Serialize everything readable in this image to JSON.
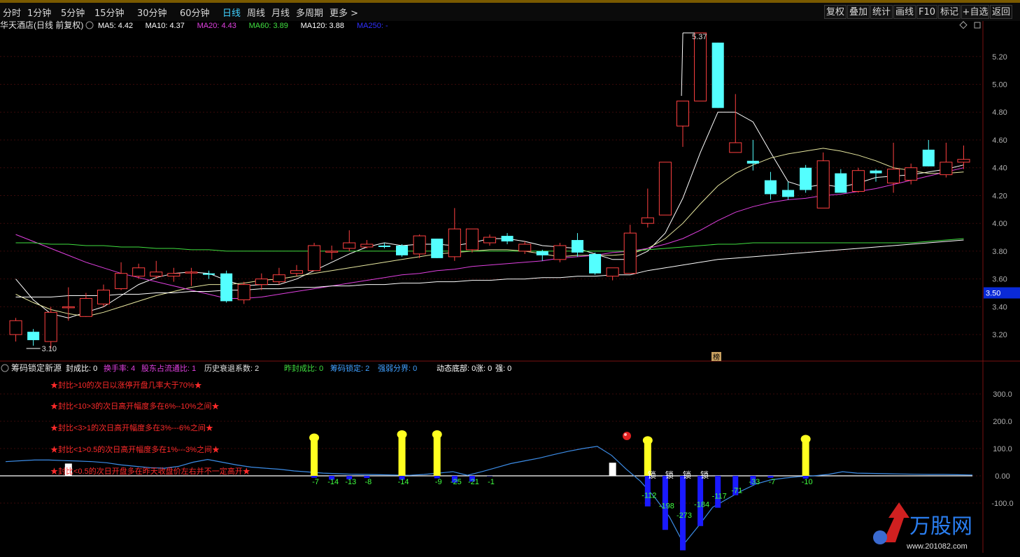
{
  "topbar": {
    "periods": [
      "分时",
      "1分钟",
      "5分钟",
      "15分钟",
      "30分钟",
      "60分钟",
      "日线",
      "周线",
      "月线",
      "多周期",
      "更多 >"
    ],
    "active_period": "日线",
    "right_buttons": [
      "复权",
      "叠加",
      "统计",
      "画线",
      "F10",
      "标记",
      "+自选",
      "返回"
    ]
  },
  "main_panel": {
    "title": "华天酒店(日线 前复权)",
    "ma_labels": [
      {
        "text": "MA5: 4.42",
        "color": "#ffffff"
      },
      {
        "text": "MA10: 4.37",
        "color": "#ffffff"
      },
      {
        "text": "MA20: 4.43",
        "color": "#e040e0"
      },
      {
        "text": "MA60: 3.89",
        "color": "#40e040"
      },
      {
        "text": "MA120: 3.88",
        "color": "#ffffff"
      },
      {
        "text": "MA250: -",
        "color": "#3030ff"
      }
    ],
    "current_price_tag": "3.50",
    "high_annotation": "5.37",
    "low_annotation": "3.10",
    "marker_glyph": "榜"
  },
  "sub_panel": {
    "title": "筹码锁定新源",
    "stats": [
      {
        "text": "封成比: 0",
        "color": "#ffffff"
      },
      {
        "text": "换手率: 4",
        "color": "#e040e0"
      },
      {
        "text": "股东占流通比: 1",
        "color": "#e040e0"
      },
      {
        "text": "历史衰退系数: 2",
        "color": "#e0e0e0"
      },
      {
        "text": "昨封成比: 0",
        "color": "#40e040"
      },
      {
        "text": "筹码锁定: 2",
        "color": "#40a0ff"
      },
      {
        "text": "强弱分界: 0",
        "color": "#40a0ff"
      },
      {
        "text": "动态底部: 0",
        "color": "#ffffff"
      },
      {
        "text": "涨: 0",
        "color": "#ffffff"
      },
      {
        "text": "强: 0",
        "color": "#ffffff"
      }
    ],
    "notes": [
      "★封比>10的次日以涨停开盘几率大于70%★",
      "★封比<10>3的次日高开幅度多在6%--10%之间★",
      "★封比<3>1的次日高开幅度多在3%---6%之间★",
      "★封比<1>0.5的次日高开幅度多在1%---3%之间★",
      "★封比<0.5的次日开盘多在昨天收盘价左右并不一定高开★"
    ],
    "lock_labels": [
      "锁",
      "锁",
      "锁",
      "锁"
    ]
  },
  "watermark": {
    "brand": "万股网",
    "url": "www.201082.com"
  },
  "chart_data": [
    {
      "type": "candlestick",
      "title": "华天酒店(日线 前复权)",
      "ylim": [
        3.1,
        5.37
      ],
      "yticks": [
        "5.20",
        "5.00",
        "4.80",
        "4.60",
        "4.40",
        "4.20",
        "4.00",
        "3.80",
        "3.60",
        "3.40",
        "3.20"
      ],
      "candles": [
        {
          "o": 3.2,
          "c": 3.3,
          "h": 3.32,
          "l": 3.15
        },
        {
          "o": 3.22,
          "c": 3.16,
          "h": 3.24,
          "l": 3.12
        },
        {
          "o": 3.15,
          "c": 3.36,
          "h": 3.4,
          "l": 3.1
        },
        {
          "o": 3.4,
          "c": 3.4,
          "h": 3.54,
          "l": 3.3
        },
        {
          "o": 3.33,
          "c": 3.46,
          "h": 3.5,
          "l": 3.33
        },
        {
          "o": 3.42,
          "c": 3.52,
          "h": 3.56,
          "l": 3.4
        },
        {
          "o": 3.53,
          "c": 3.64,
          "h": 3.72,
          "l": 3.52
        },
        {
          "o": 3.62,
          "c": 3.68,
          "h": 3.71,
          "l": 3.6
        },
        {
          "o": 3.62,
          "c": 3.65,
          "h": 3.73,
          "l": 3.6
        },
        {
          "o": 3.62,
          "c": 3.64,
          "h": 3.68,
          "l": 3.58
        },
        {
          "o": 3.65,
          "c": 3.65,
          "h": 3.68,
          "l": 3.55
        },
        {
          "o": 3.64,
          "c": 3.63,
          "h": 3.66,
          "l": 3.6
        },
        {
          "o": 3.64,
          "c": 3.44,
          "h": 3.66,
          "l": 3.43
        },
        {
          "o": 3.45,
          "c": 3.56,
          "h": 3.58,
          "l": 3.42
        },
        {
          "o": 3.56,
          "c": 3.6,
          "h": 3.64,
          "l": 3.52
        },
        {
          "o": 3.58,
          "c": 3.63,
          "h": 3.68,
          "l": 3.56
        },
        {
          "o": 3.64,
          "c": 3.66,
          "h": 3.7,
          "l": 3.62
        },
        {
          "o": 3.66,
          "c": 3.84,
          "h": 3.86,
          "l": 3.66
        },
        {
          "o": 3.8,
          "c": 3.8,
          "h": 3.84,
          "l": 3.74
        },
        {
          "o": 3.82,
          "c": 3.86,
          "h": 3.95,
          "l": 3.8
        },
        {
          "o": 3.83,
          "c": 3.85,
          "h": 3.88,
          "l": 3.82
        },
        {
          "o": 3.84,
          "c": 3.83,
          "h": 3.86,
          "l": 3.82
        },
        {
          "o": 3.84,
          "c": 3.77,
          "h": 3.85,
          "l": 3.76
        },
        {
          "o": 3.78,
          "c": 3.91,
          "h": 3.92,
          "l": 3.75
        },
        {
          "o": 3.89,
          "c": 3.75,
          "h": 3.89,
          "l": 3.75
        },
        {
          "o": 3.76,
          "c": 3.96,
          "h": 4.11,
          "l": 3.73
        },
        {
          "o": 3.81,
          "c": 3.96,
          "h": 3.96,
          "l": 3.79
        },
        {
          "o": 3.86,
          "c": 3.9,
          "h": 3.92,
          "l": 3.84
        },
        {
          "o": 3.91,
          "c": 3.87,
          "h": 3.93,
          "l": 3.85
        },
        {
          "o": 3.8,
          "c": 3.85,
          "h": 3.87,
          "l": 3.78
        },
        {
          "o": 3.8,
          "c": 3.77,
          "h": 3.81,
          "l": 3.73
        },
        {
          "o": 3.74,
          "c": 3.84,
          "h": 3.86,
          "l": 3.72
        },
        {
          "o": 3.88,
          "c": 3.79,
          "h": 3.93,
          "l": 3.76
        },
        {
          "o": 3.78,
          "c": 3.64,
          "h": 3.79,
          "l": 3.63
        },
        {
          "o": 3.62,
          "c": 3.68,
          "h": 3.68,
          "l": 3.59
        },
        {
          "o": 3.64,
          "c": 3.93,
          "h": 3.99,
          "l": 3.64
        },
        {
          "o": 4.0,
          "c": 4.04,
          "h": 4.25,
          "l": 3.97
        },
        {
          "o": 4.06,
          "c": 4.44,
          "h": 4.44,
          "l": 4.06
        },
        {
          "o": 4.7,
          "c": 4.88,
          "h": 4.88,
          "l": 4.55
        },
        {
          "o": 4.88,
          "c": 5.37,
          "h": 5.37,
          "l": 4.91
        },
        {
          "o": 5.3,
          "c": 4.83,
          "h": 5.3,
          "l": 4.83
        },
        {
          "o": 4.51,
          "c": 4.58,
          "h": 4.93,
          "l": 4.51
        },
        {
          "o": 4.45,
          "c": 4.43,
          "h": 4.6,
          "l": 4.38
        },
        {
          "o": 4.31,
          "c": 4.21,
          "h": 4.37,
          "l": 4.17
        },
        {
          "o": 4.24,
          "c": 4.19,
          "h": 4.3,
          "l": 4.17
        },
        {
          "o": 4.4,
          "c": 4.24,
          "h": 4.42,
          "l": 4.22
        },
        {
          "o": 4.11,
          "c": 4.45,
          "h": 4.51,
          "l": 4.11
        },
        {
          "o": 4.36,
          "c": 4.22,
          "h": 4.39,
          "l": 4.22
        },
        {
          "o": 4.23,
          "c": 4.38,
          "h": 4.4,
          "l": 4.22
        },
        {
          "o": 4.38,
          "c": 4.36,
          "h": 4.39,
          "l": 4.3
        },
        {
          "o": 4.29,
          "c": 4.39,
          "h": 4.58,
          "l": 4.22
        },
        {
          "o": 4.31,
          "c": 4.4,
          "h": 4.43,
          "l": 4.28
        },
        {
          "o": 4.53,
          "c": 4.41,
          "h": 4.6,
          "l": 4.41
        },
        {
          "o": 4.35,
          "c": 4.44,
          "h": 4.58,
          "l": 4.33
        },
        {
          "o": 4.44,
          "c": 4.46,
          "h": 4.56,
          "l": 4.39
        }
      ],
      "ma": [
        {
          "name": "MA5",
          "color": "#ffffff",
          "values": [
            3.6,
            3.45,
            3.35,
            3.32,
            3.36,
            3.4,
            3.48,
            3.56,
            3.61,
            3.64,
            3.65,
            3.64,
            3.59,
            3.55,
            3.56,
            3.56,
            3.6,
            3.66,
            3.72,
            3.78,
            3.83,
            3.86,
            3.84,
            3.85,
            3.85,
            3.84,
            3.86,
            3.89,
            3.89,
            3.87,
            3.84,
            3.83,
            3.82,
            3.78,
            3.74,
            3.74,
            3.8,
            3.93,
            4.18,
            4.51,
            4.8,
            4.8,
            4.73,
            4.51,
            4.3,
            4.26,
            4.28,
            4.26,
            4.29,
            4.33,
            4.34,
            4.35,
            4.37,
            4.39,
            4.42
          ]
        },
        {
          "name": "MA10",
          "color": "#e8e8a0",
          "values": [
            3.49,
            3.43,
            3.38,
            3.35,
            3.33,
            3.36,
            3.4,
            3.44,
            3.48,
            3.51,
            3.54,
            3.56,
            3.56,
            3.57,
            3.59,
            3.6,
            3.62,
            3.64,
            3.66,
            3.68,
            3.7,
            3.72,
            3.74,
            3.76,
            3.78,
            3.79,
            3.8,
            3.81,
            3.81,
            3.8,
            3.78,
            3.76,
            3.77,
            3.77,
            3.77,
            3.78,
            3.82,
            3.89,
            4.0,
            4.14,
            4.27,
            4.36,
            4.42,
            4.47,
            4.5,
            4.52,
            4.54,
            4.52,
            4.49,
            4.45,
            4.4,
            4.38,
            4.36,
            4.36,
            4.37
          ]
        },
        {
          "name": "MA20",
          "color": "#e040e0",
          "values": [
            3.92,
            3.87,
            3.82,
            3.77,
            3.72,
            3.68,
            3.64,
            3.61,
            3.58,
            3.55,
            3.52,
            3.49,
            3.46,
            3.46,
            3.47,
            3.49,
            3.51,
            3.53,
            3.55,
            3.57,
            3.59,
            3.61,
            3.63,
            3.64,
            3.66,
            3.67,
            3.69,
            3.7,
            3.71,
            3.72,
            3.73,
            3.75,
            3.76,
            3.77,
            3.79,
            3.8,
            3.82,
            3.85,
            3.89,
            3.95,
            4.02,
            4.08,
            4.12,
            4.15,
            4.17,
            4.18,
            4.2,
            4.21,
            4.23,
            4.25,
            4.28,
            4.31,
            4.34,
            4.37,
            4.4
          ]
        },
        {
          "name": "MA60",
          "color": "#40e040",
          "values": [
            3.86,
            3.86,
            3.85,
            3.85,
            3.84,
            3.84,
            3.83,
            3.83,
            3.82,
            3.82,
            3.81,
            3.81,
            3.8,
            3.8,
            3.8,
            3.8,
            3.8,
            3.8,
            3.8,
            3.8,
            3.8,
            3.8,
            3.8,
            3.8,
            3.8,
            3.8,
            3.8,
            3.8,
            3.8,
            3.8,
            3.8,
            3.8,
            3.8,
            3.8,
            3.8,
            3.8,
            3.81,
            3.82,
            3.83,
            3.84,
            3.85,
            3.85,
            3.86,
            3.86,
            3.86,
            3.86,
            3.86,
            3.86,
            3.86,
            3.86,
            3.86,
            3.86,
            3.87,
            3.88,
            3.89
          ]
        },
        {
          "name": "MA120",
          "color": "#ffffff",
          "values": [
            3.47,
            3.47,
            3.47,
            3.48,
            3.48,
            3.48,
            3.49,
            3.49,
            3.5,
            3.5,
            3.51,
            3.51,
            3.52,
            3.52,
            3.53,
            3.53,
            3.54,
            3.54,
            3.55,
            3.55,
            3.56,
            3.56,
            3.57,
            3.57,
            3.58,
            3.58,
            3.59,
            3.59,
            3.6,
            3.6,
            3.61,
            3.61,
            3.62,
            3.62,
            3.63,
            3.63,
            3.66,
            3.68,
            3.7,
            3.72,
            3.74,
            3.75,
            3.76,
            3.77,
            3.78,
            3.79,
            3.8,
            3.81,
            3.82,
            3.83,
            3.84,
            3.85,
            3.86,
            3.87,
            3.88
          ]
        }
      ]
    },
    {
      "type": "bar",
      "title": "筹码锁定新源",
      "ylim": [
        -100,
        300
      ],
      "yticks": [
        "300.0",
        "200.0",
        "100.0",
        "0.00",
        "-100.0"
      ],
      "line_values": [
        52,
        55,
        58,
        58,
        56,
        54,
        52,
        48,
        40,
        35,
        30,
        28,
        35,
        50,
        60,
        50,
        40,
        32,
        28,
        24,
        18,
        14,
        10,
        8,
        6,
        5,
        4,
        3,
        2,
        5,
        10,
        15,
        2,
        15,
        30,
        45,
        55,
        65,
        78,
        90,
        100,
        108,
        75,
        25,
        -20,
        -80,
        -150,
        -250,
        -185,
        -115,
        -85,
        -55,
        -30,
        -15,
        -8,
        -3,
        0,
        5,
        15,
        10,
        9,
        8,
        7,
        6,
        5,
        5,
        4,
        3
      ],
      "yellow_bars": [
        {
          "index": 17,
          "value": 150
        },
        {
          "index": 22,
          "value": 162
        },
        {
          "index": 24,
          "value": 162
        },
        {
          "index": 36,
          "value": 140
        },
        {
          "index": 45,
          "value": 145
        }
      ],
      "white_bars": [
        {
          "index": 3,
          "value": 45
        },
        {
          "index": 34,
          "value": 48
        }
      ],
      "blue_bars": [
        {
          "index": 17,
          "value": -7,
          "label": "-7"
        },
        {
          "index": 18,
          "value": -14,
          "label": "-14"
        },
        {
          "index": 19,
          "value": -13,
          "label": "-13"
        },
        {
          "index": 20,
          "value": -8,
          "label": "-8"
        },
        {
          "index": 22,
          "value": -14,
          "label": "-14"
        },
        {
          "index": 24,
          "value": -9,
          "label": "-9"
        },
        {
          "index": 25,
          "value": -25,
          "label": "-25"
        },
        {
          "index": 26,
          "value": -21,
          "label": "-21"
        },
        {
          "index": 27,
          "value": -1,
          "label": "-1"
        },
        {
          "index": 36,
          "value": -112,
          "label": "-112"
        },
        {
          "index": 37,
          "value": -198,
          "label": "-198"
        },
        {
          "index": 38,
          "value": -273,
          "label": "-273"
        },
        {
          "index": 39,
          "value": -184,
          "label": "-184"
        },
        {
          "index": 40,
          "value": -117,
          "label": "-117"
        },
        {
          "index": 41,
          "value": -71,
          "label": "-71"
        },
        {
          "index": 42,
          "value": -33,
          "label": "-33"
        },
        {
          "index": 43,
          "value": -7,
          "label": "-7"
        },
        {
          "index": 45,
          "value": -10,
          "label": "-10"
        }
      ]
    }
  ]
}
